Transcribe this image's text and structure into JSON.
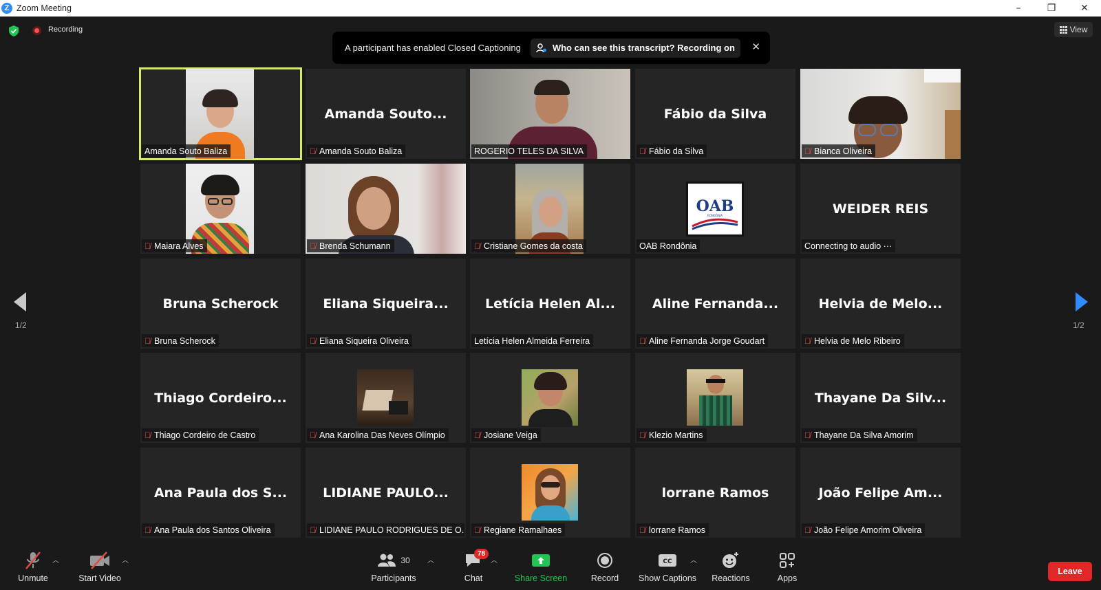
{
  "window": {
    "title": "Zoom Meeting",
    "minimize": "–",
    "restore": "❐",
    "close": "✕"
  },
  "topbar": {
    "recording_label": "Recording",
    "view_label": "View"
  },
  "banner": {
    "message": "A participant has enabled Closed Captioning",
    "action": "Who can see this transcript? Recording on",
    "close": "✕"
  },
  "pagination": {
    "left": "1/2",
    "right": "1/2"
  },
  "tiles": [
    {
      "name": "Amanda Souto Baliza",
      "big": "",
      "muted": false,
      "video": "person-a"
    },
    {
      "name": "Amanda Souto Baliza",
      "big": "Amanda Souto...",
      "muted": true,
      "video": ""
    },
    {
      "name": "ROGERIO TELES DA SILVA",
      "big": "",
      "muted": false,
      "video": "person-b"
    },
    {
      "name": "Fábio da Silva",
      "big": "Fábio da Silva",
      "muted": true,
      "video": ""
    },
    {
      "name": "Bianca Oliveira",
      "big": "",
      "muted": true,
      "video": "person-c"
    },
    {
      "name": "Maiara Alves",
      "big": "",
      "muted": true,
      "video": "person-d"
    },
    {
      "name": "Brenda Schumann",
      "big": "",
      "muted": true,
      "video": "person-e"
    },
    {
      "name": "Cristiane Gomes da costa",
      "big": "",
      "muted": true,
      "video": "person-f"
    },
    {
      "name": "OAB Rondônia",
      "big": "",
      "muted": false,
      "video": "oab-logo"
    },
    {
      "name": "Connecting to audio ···",
      "big": "WEIDER REIS",
      "muted": false,
      "video": ""
    },
    {
      "name": "Bruna Scherock",
      "big": "Bruna Scherock",
      "muted": true,
      "video": ""
    },
    {
      "name": "Eliana Siqueira Oliveira",
      "big": "Eliana Siqueira...",
      "muted": true,
      "video": ""
    },
    {
      "name": "Letícia Helen Almeida Ferreira",
      "big": "Letícia Helen Al...",
      "muted": false,
      "video": ""
    },
    {
      "name": "Aline Fernanda Jorge Goudart",
      "big": "Aline Fernanda...",
      "muted": true,
      "video": ""
    },
    {
      "name": "Helvia de Melo Ribeiro",
      "big": "Helvia de Melo...",
      "muted": true,
      "video": ""
    },
    {
      "name": "Thiago Cordeiro de Castro",
      "big": "Thiago Cordeiro...",
      "muted": true,
      "video": ""
    },
    {
      "name": "Ana Karolina Das Neves Olímpio",
      "big": "",
      "muted": true,
      "video": "thumb-desk"
    },
    {
      "name": "Josiane Veiga",
      "big": "",
      "muted": true,
      "video": "thumb-portrait"
    },
    {
      "name": "Klezio Martins",
      "big": "",
      "muted": true,
      "video": "thumb-outdoor"
    },
    {
      "name": "Thayane Da Silva Amorim",
      "big": "Thayane Da Silv...",
      "muted": true,
      "video": ""
    },
    {
      "name": "Ana Paula dos Santos Oliveira",
      "big": "Ana Paula dos S...",
      "muted": true,
      "video": ""
    },
    {
      "name": "LIDIANE PAULO RODRIGUES DE O...",
      "big": "LIDIANE PAULO...",
      "muted": true,
      "video": ""
    },
    {
      "name": "Regiane Ramalhaes",
      "big": "",
      "muted": true,
      "video": "thumb-beach"
    },
    {
      "name": "lorrane Ramos",
      "big": "lorrane Ramos",
      "muted": true,
      "video": ""
    },
    {
      "name": "João Felipe Amorim Oliveira",
      "big": "João Felipe Am...",
      "muted": true,
      "video": ""
    }
  ],
  "toolbar": {
    "unmute": "Unmute",
    "start_video": "Start Video",
    "participants": "Participants",
    "participants_count": "30",
    "chat": "Chat",
    "chat_badge": "78",
    "share_screen": "Share Screen",
    "record": "Record",
    "show_captions": "Show Captions",
    "reactions": "Reactions",
    "apps": "Apps",
    "leave": "Leave"
  },
  "colors": {
    "accent": "#2d8cff",
    "active_speaker": "#d6e86e",
    "leave": "#e02828",
    "share": "#23c552",
    "muted": "#e34b4b"
  }
}
